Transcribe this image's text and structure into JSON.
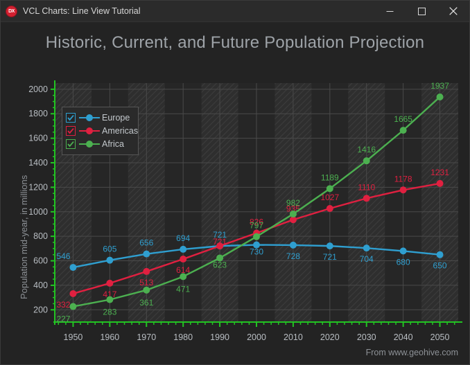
{
  "window": {
    "title": "VCL Charts: Line View Tutorial",
    "icon": "dx-logo-icon",
    "minimize_label": "–",
    "maximize_label": "☐",
    "close_label": "✕"
  },
  "footer": {
    "text": "From www.geohive.com"
  },
  "legend": {
    "items": [
      {
        "label": "Europe",
        "color": "#2f9fd0",
        "checked": true
      },
      {
        "label": "Americas",
        "color": "#e02040",
        "checked": true
      },
      {
        "label": "Africa",
        "color": "#4cb050",
        "checked": true
      }
    ]
  },
  "chart_data": {
    "type": "line",
    "title": "Historic, Current, and Future Population Projection",
    "xlabel": "",
    "ylabel": "Population mid-year, in millions",
    "x": [
      1950,
      1960,
      1970,
      1980,
      1990,
      2000,
      2010,
      2020,
      2030,
      2040,
      2050
    ],
    "xticks": [
      "1950",
      "1960",
      "1970",
      "1980",
      "1990",
      "2000",
      "2010",
      "2020",
      "2030",
      "2040",
      "2050"
    ],
    "yticks": [
      "200",
      "400",
      "600",
      "800",
      "1000",
      "1200",
      "1400",
      "1600",
      "1800",
      "2000"
    ],
    "ylim": [
      100,
      2050
    ],
    "xlim": [
      1945,
      2055
    ],
    "grid": true,
    "legend_position": "top-left",
    "series": [
      {
        "name": "Europe",
        "color": "#2f9fd0",
        "values": [
          546,
          605,
          656,
          694,
          721,
          730,
          728,
          721,
          704,
          680,
          650
        ],
        "labels": [
          "546",
          "605",
          "656",
          "694",
          "721",
          "730",
          "728",
          "721",
          "704",
          "680",
          "650"
        ]
      },
      {
        "name": "Americas",
        "color": "#e02040",
        "values": [
          332,
          417,
          513,
          614,
          721,
          826,
          935,
          1027,
          1110,
          1178,
          1231
        ],
        "labels": [
          "332",
          "417",
          "513",
          "614",
          "721",
          "826",
          "935",
          "1027",
          "1110",
          "1178",
          "1231"
        ]
      },
      {
        "name": "Africa",
        "color": "#4cb050",
        "values": [
          227,
          283,
          361,
          471,
          623,
          797,
          982,
          1189,
          1416,
          1665,
          1937
        ],
        "labels": [
          "227",
          "283",
          "361",
          "471",
          "623",
          "797",
          "982",
          "1189",
          "1416",
          "1665",
          "1937"
        ]
      }
    ]
  }
}
